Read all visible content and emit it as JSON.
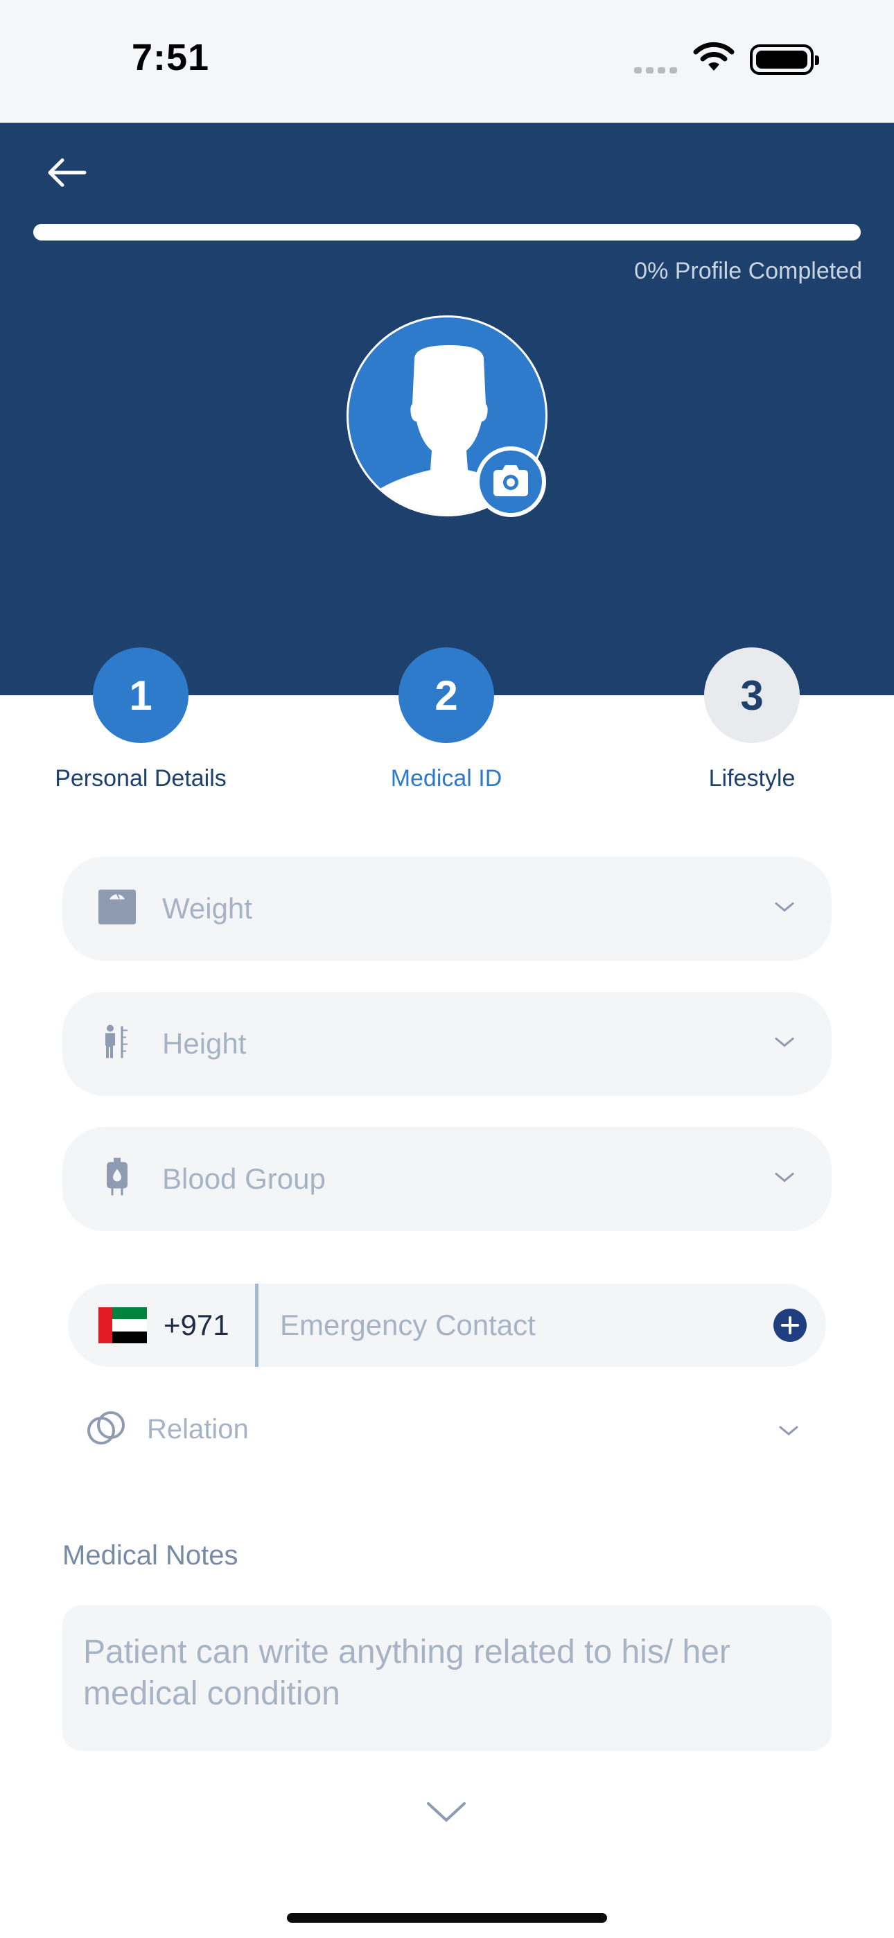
{
  "status_bar": {
    "time": "7:51"
  },
  "header": {
    "profile_completion_percent": 0,
    "progress_label": "0% Profile Completed"
  },
  "steps": [
    {
      "number": "1",
      "label": "Personal Details",
      "state": "done",
      "color": "#2e7acb"
    },
    {
      "number": "2",
      "label": "Medical ID",
      "state": "active",
      "color": "#2e7acb"
    },
    {
      "number": "3",
      "label": "Lifestyle",
      "state": "upcoming",
      "color": "#e9eaed"
    }
  ],
  "fields": {
    "weight": {
      "placeholder": "Weight",
      "icon": "weight-scale-icon"
    },
    "height": {
      "placeholder": "Height",
      "icon": "height-ruler-icon"
    },
    "blood_group": {
      "placeholder": "Blood Group",
      "icon": "blood-bag-icon"
    }
  },
  "emergency": {
    "country_code": "+971",
    "flag": "uae-flag-icon",
    "placeholder": "Emergency Contact"
  },
  "relation": {
    "placeholder": "Relation",
    "icon": "relation-rings-icon"
  },
  "notes": {
    "title": "Medical Notes",
    "placeholder": "Patient can write anything related to his/ her medical condition"
  },
  "colors": {
    "header_bg": "#1d406d",
    "accent": "#2e7acb",
    "field_bg": "#f4f5f7",
    "placeholder": "#a6b3c5"
  }
}
